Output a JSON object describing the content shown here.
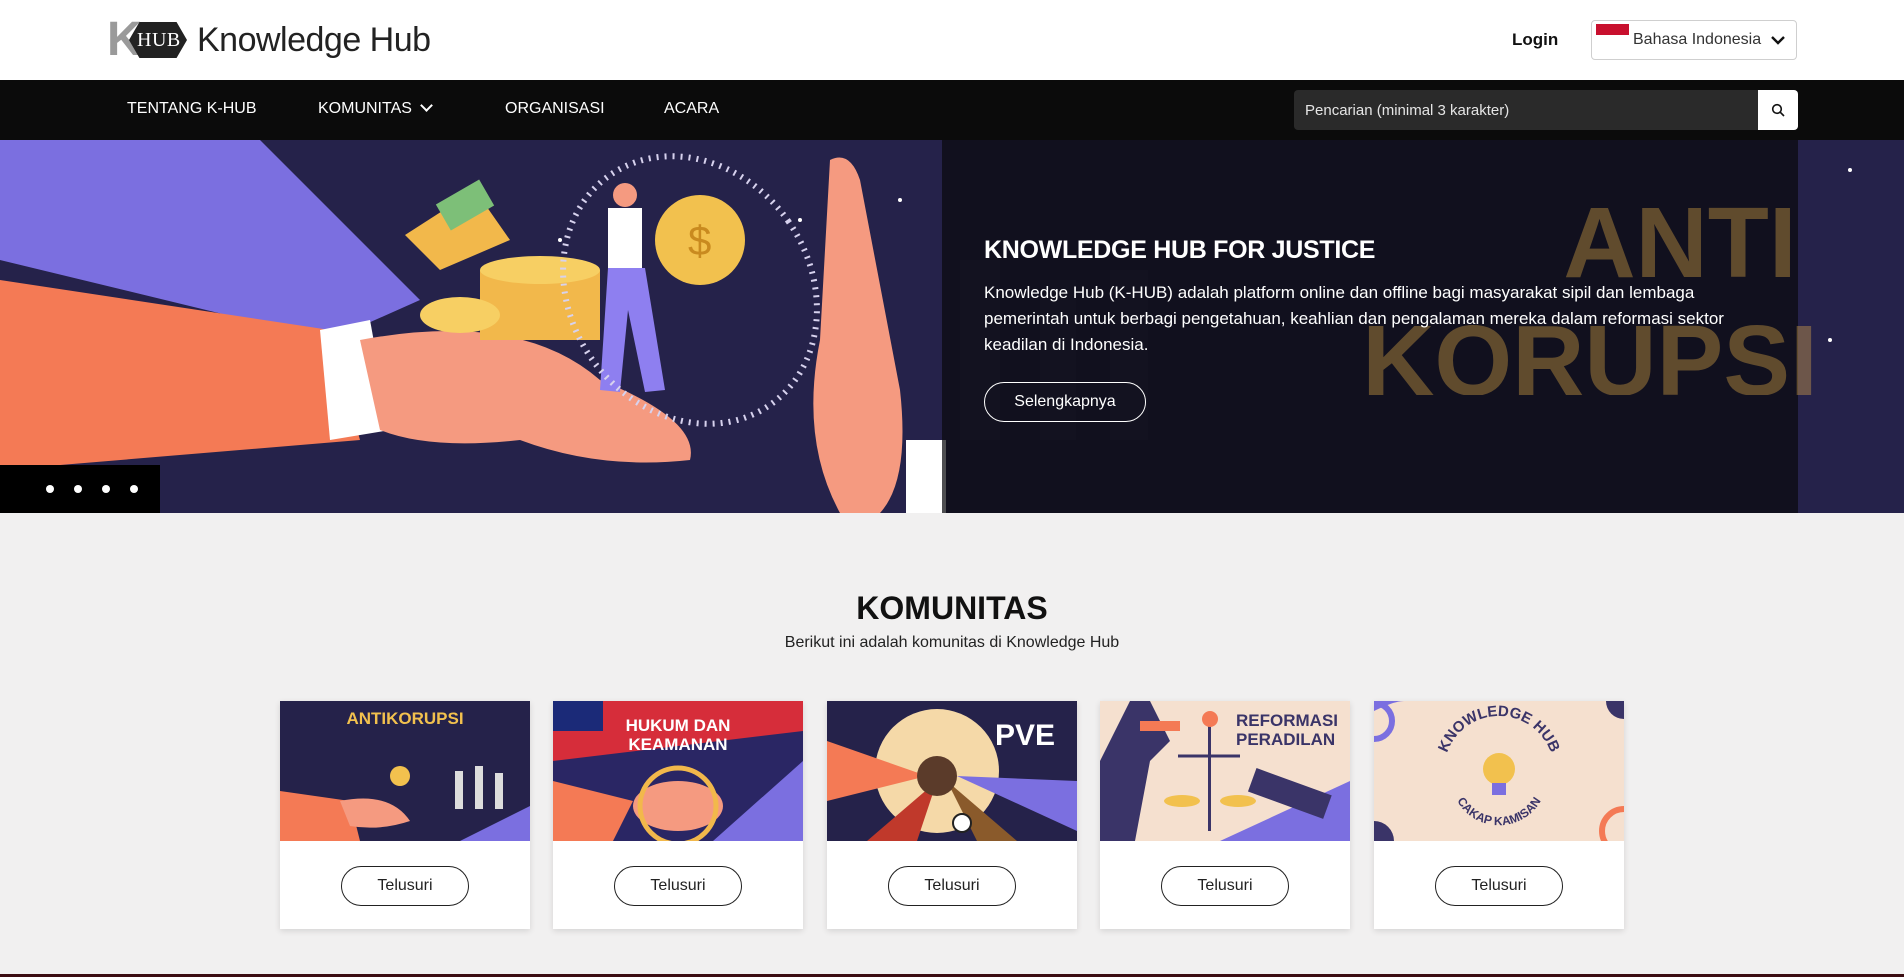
{
  "header": {
    "logo_text": "Knowledge Hub",
    "logo_mark_letter": "K",
    "logo_mark_hub": "HUB",
    "login_label": "Login",
    "language": {
      "selected": "Bahasa Indonesia",
      "flag": "indonesia-flag-icon"
    }
  },
  "nav": {
    "items": [
      {
        "label": "TENTANG K-HUB"
      },
      {
        "label": "KOMUNITAS",
        "has_dropdown": true
      },
      {
        "label": "ORGANISASI"
      },
      {
        "label": "ACARA"
      }
    ],
    "search": {
      "placeholder": "Pencarian (minimal 3 karakter)",
      "icon": "search-icon"
    }
  },
  "hero": {
    "title": "KNOWLEDGE HUB FOR JUSTICE",
    "description": "Knowledge Hub (K-HUB) adalah platform online dan offline bagi masyarakat sipil dan lembaga pemerintah untuk berbagi pengetahuan, keahlian dan pengalaman mereka dalam reformasi sektor keadilan di Indonesia.",
    "button_label": "Selengkapnya",
    "background_text_line1": "ANTI",
    "background_text_line2": "KORUPSI",
    "slide_count": 4
  },
  "communities": {
    "title": "KOMUNITAS",
    "subtitle": "Berikut ini adalah komunitas di Knowledge Hub",
    "cards": [
      {
        "image_label": "ANTIKORUPSI",
        "button_label": "Telusuri"
      },
      {
        "image_label_line1": "HUKUM DAN",
        "image_label_line2": "KEAMANAN",
        "button_label": "Telusuri"
      },
      {
        "image_label": "PVE",
        "button_label": "Telusuri"
      },
      {
        "image_label_line1": "REFORMASI",
        "image_label_line2": "PERADILAN",
        "button_label": "Telusuri"
      },
      {
        "image_label_top": "KNOWLEDGE HUB",
        "image_label_bottom": "CAKAP KAMISAN",
        "button_label": "Telusuri"
      }
    ]
  },
  "colors": {
    "nav_bg": "#0b0b0b",
    "hero_bg": "#25224a",
    "accent_gold": "#f2c14e",
    "page_bg": "#f1f0f0"
  }
}
